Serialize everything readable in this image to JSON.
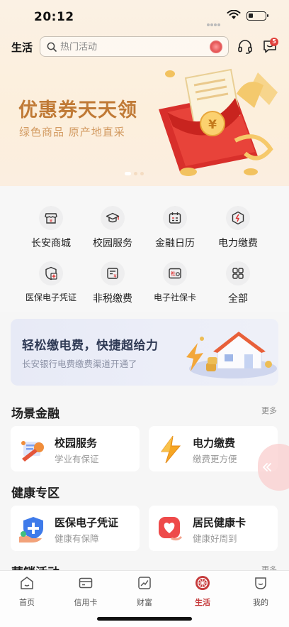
{
  "status_bar": {
    "time": "20:12"
  },
  "header": {
    "title": "生活",
    "search_placeholder": "热门活动",
    "message_badge": "5"
  },
  "banner": {
    "title": "优惠券天天领",
    "subtitle": "绿色商品 原产地直采"
  },
  "services": [
    {
      "label": "长安商城",
      "icon": "shop-icon"
    },
    {
      "label": "校园服务",
      "icon": "graduation-cap-icon"
    },
    {
      "label": "金融日历",
      "icon": "calendar-icon"
    },
    {
      "label": "电力缴费",
      "icon": "lightning-icon"
    },
    {
      "label": "医保电子凭证",
      "icon": "medical-shield-icon"
    },
    {
      "label": "非税缴费",
      "icon": "tax-bill-icon"
    },
    {
      "label": "电子社保卡",
      "icon": "social-security-card-icon"
    },
    {
      "label": "全部",
      "icon": "all-grid-icon"
    }
  ],
  "ad": {
    "title": "轻松缴电费，快捷超给力",
    "subtitle": "长安银行电费缴费渠道开通了"
  },
  "sections": {
    "scene_finance": {
      "title": "场景金融",
      "more": "更多",
      "cards": [
        {
          "title": "校园服务",
          "subtitle": "学业有保证"
        },
        {
          "title": "电力缴费",
          "subtitle": "缴费更方便"
        }
      ]
    },
    "health": {
      "title": "健康专区",
      "cards": [
        {
          "title": "医保电子凭证",
          "subtitle": "健康有保障"
        },
        {
          "title": "居民健康卡",
          "subtitle": "健康好周到"
        }
      ]
    },
    "marketing": {
      "title": "营销活动",
      "more": "更多"
    }
  },
  "tabbar": [
    {
      "label": "首页",
      "icon": "home-icon"
    },
    {
      "label": "信用卡",
      "icon": "credit-card-icon"
    },
    {
      "label": "财富",
      "icon": "wealth-chart-icon"
    },
    {
      "label": "生活",
      "icon": "life-emblem-icon",
      "active": true
    },
    {
      "label": "我的",
      "icon": "profile-icon"
    }
  ],
  "colors": {
    "accent": "#c5393a",
    "banner_title": "#c07a36",
    "banner_bg": "#fcefdc",
    "ad_bg": "#e7eaf6"
  }
}
